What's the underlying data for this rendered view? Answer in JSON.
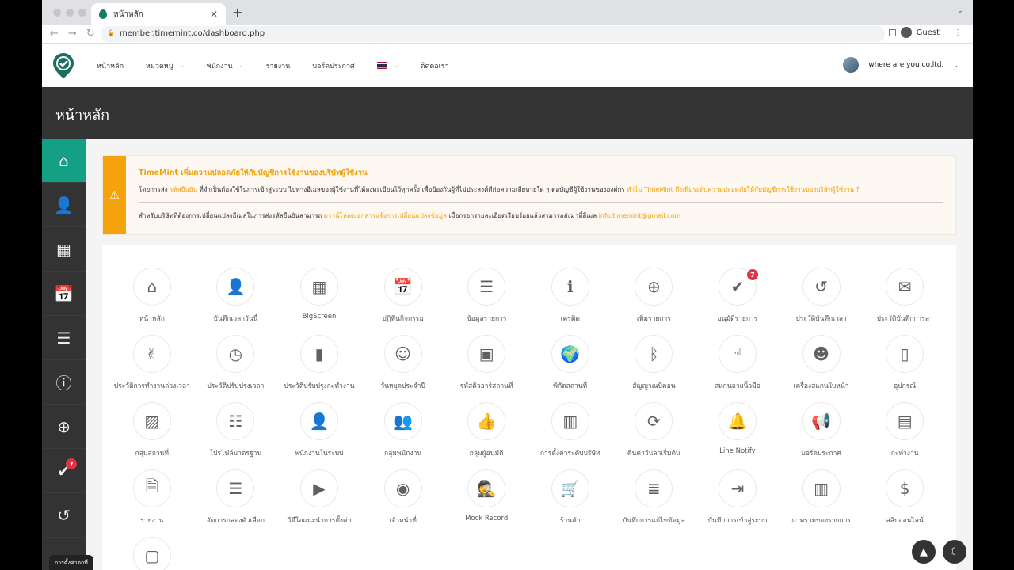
{
  "browser": {
    "tab_title": "หน้าหลัก",
    "url": "member.timemint.co/dashboard.php",
    "profile": "Guest"
  },
  "nav": {
    "items": [
      {
        "label": "หน้าหลัก",
        "dropdown": false
      },
      {
        "label": "หมวดหมู่",
        "dropdown": true
      },
      {
        "label": "พนักงาน",
        "dropdown": true
      },
      {
        "label": "รายงาน",
        "dropdown": false
      },
      {
        "label": "บอร์ดประกาศ",
        "dropdown": false
      },
      {
        "label": "",
        "flag": "thai-flag",
        "dropdown": true
      },
      {
        "label": "ติดต่อเรา",
        "dropdown": false
      }
    ],
    "company": "where are you co.ltd."
  },
  "header": {
    "title": "หน้าหลัก"
  },
  "sidebar": {
    "items": [
      {
        "icon": "home-icon",
        "glyph": "⌂",
        "active": true
      },
      {
        "icon": "user-clock-icon",
        "glyph": "👤"
      },
      {
        "icon": "table-icon",
        "glyph": "▦"
      },
      {
        "icon": "calendar-icon",
        "glyph": "📅"
      },
      {
        "icon": "list-icon",
        "glyph": "☰"
      },
      {
        "icon": "info-icon",
        "glyph": "ⓘ"
      },
      {
        "icon": "plus-circle-icon",
        "glyph": "⊕"
      },
      {
        "icon": "check-circle-icon",
        "glyph": "✔",
        "badge": "7"
      },
      {
        "icon": "history-icon",
        "glyph": "↺"
      },
      {
        "icon": "more-icon",
        "glyph": "▭"
      }
    ],
    "tooltip": "การตั้งค่าตกที่"
  },
  "alert": {
    "title": "TimeMint เพิ่มความปลอดภัยให้กับบัญชีการใช้งานของบริษัทผู้ใช้งาน",
    "line1_a": "โดยการส่ง ",
    "line1_hl": "รหัสยืนยัน",
    "line1_b": " ที่จำเป็นต้องใช้ในการเข้าสู่ระบบ ไปทางอีเมลของผู้ใช้งานที่ได้ลงทะเบียนไว้ทุกครั้ง เพื่อป้องกันผู้ที่ไม่ประสงค์ดีก่อความเสียหายใด ๆ ต่อบัญชีผู้ใช้งานขององค์กร ",
    "line1_link": "ทำไม TimeMint ถึงเพิ่มระดับความปลอดภัยให้กับบัญชีการใช้งานของบริษัทผู้ใช้งาน ?",
    "line2_a": "สำหรับบริษัทที่ต้องการเปลี่ยนแปลงอีเมลในการส่งรหัสยืนยันสามารถ ",
    "line2_link": "ดาวน์โหลดเอกสารแจ้งการเปลี่ยนแปลงข้อมูล",
    "line2_b": " เมื่อกรอกรายละเอียดเรียบร้อยแล้วสามารถส่งมาที่อีเมล ",
    "email": "info.timemint@gmail.com"
  },
  "tiles": [
    {
      "label": "หน้าหลัก",
      "icon": "home-icon",
      "glyph": "⌂"
    },
    {
      "label": "บันทึกเวลาวันนี้",
      "icon": "user-clock-icon",
      "glyph": "👤"
    },
    {
      "label": "BigScreen",
      "icon": "table-icon",
      "glyph": "▦"
    },
    {
      "label": "ปฏิทินกิจกรรม",
      "icon": "calendar-icon",
      "glyph": "📅"
    },
    {
      "label": "ข้อมูลรายการ",
      "icon": "list-icon",
      "glyph": "☰"
    },
    {
      "label": "เครดิต",
      "icon": "info-icon",
      "glyph": "ℹ"
    },
    {
      "label": "เพิ่มรายการ",
      "icon": "plus-circle-icon",
      "glyph": "⊕"
    },
    {
      "label": "อนุมัติรายการ",
      "icon": "check-circle-icon",
      "glyph": "✔",
      "badge": "7"
    },
    {
      "label": "ประวัติบันทึกเวลา",
      "icon": "history-icon",
      "glyph": "↺"
    },
    {
      "label": "ประวัติบันทึกการลา",
      "icon": "envelope-icon",
      "glyph": "✉"
    },
    {
      "label": "ประวัติการทำงานล่วงเวลา",
      "icon": "hand-peace-icon",
      "glyph": "✌"
    },
    {
      "label": "ประวัติปรับปรุงเวลา",
      "icon": "clock-icon",
      "glyph": "◷"
    },
    {
      "label": "ประวัติปรับปรุงกะทำงาน",
      "icon": "book-icon",
      "glyph": "▮"
    },
    {
      "label": "วันหยุดประจำปี",
      "icon": "smile-icon",
      "glyph": "☺"
    },
    {
      "label": "รหัสคิวอาร์สถานที่",
      "icon": "qrcode-icon",
      "glyph": "▣"
    },
    {
      "label": "พิกัดสถานที่",
      "icon": "globe-icon",
      "glyph": "🌍"
    },
    {
      "label": "สัญญาณบีคอน",
      "icon": "bluetooth-icon",
      "glyph": "ᛒ"
    },
    {
      "label": "สแกนลายนิ้วมือ",
      "icon": "hand-pointer-icon",
      "glyph": "☝"
    },
    {
      "label": "เครื่องสแกนใบหน้า",
      "icon": "face-icon",
      "glyph": "☻"
    },
    {
      "label": "อุปกรณ์",
      "icon": "mobile-icon",
      "glyph": "▯"
    },
    {
      "label": "กลุ่มสถานที่",
      "icon": "image-icon",
      "glyph": "▨"
    },
    {
      "label": "โปรไฟล์มาตรฐาน",
      "icon": "list-alt-icon",
      "glyph": "☷"
    },
    {
      "label": "พนักงานในระบบ",
      "icon": "user-icon",
      "glyph": "👤"
    },
    {
      "label": "กลุ่มพนักงาน",
      "icon": "users-icon",
      "glyph": "👥"
    },
    {
      "label": "กลุ่มผู้อนุมัติ",
      "icon": "thumbs-up-icon",
      "glyph": "👍"
    },
    {
      "label": "การตั้งค่าระดับบริษัท",
      "icon": "building-icon",
      "glyph": "▥"
    },
    {
      "label": "คืนค่าวันลาเริ่มต้น",
      "icon": "sync-icon",
      "glyph": "⟳"
    },
    {
      "label": "Line Notify",
      "icon": "bell-icon",
      "glyph": "🔔"
    },
    {
      "label": "บอร์ดประกาศ",
      "icon": "bullhorn-icon",
      "glyph": "📢"
    },
    {
      "label": "กะทำงาน",
      "icon": "book-icon",
      "glyph": "▤"
    },
    {
      "label": "รายงาน",
      "icon": "file-icon",
      "glyph": "🗎"
    },
    {
      "label": "จัดการกล่องตัวเลือก",
      "icon": "list-ul-icon",
      "glyph": "☰"
    },
    {
      "label": "วีดีโอแนะนำการตั้งค่า",
      "icon": "youtube-icon",
      "glyph": "▶"
    },
    {
      "label": "เจ้าหน้าที่",
      "icon": "user-circle-icon",
      "glyph": "◉"
    },
    {
      "label": "Mock Record",
      "icon": "user-secret-icon",
      "glyph": "🕵"
    },
    {
      "label": "ร้านค้า",
      "icon": "cart-icon",
      "glyph": "🛒"
    },
    {
      "label": "บันทึกการแก้ไขข้อมูล",
      "icon": "database-icon",
      "glyph": "≣"
    },
    {
      "label": "บันทึกการเข้าสู่ระบบ",
      "icon": "sign-in-icon",
      "glyph": "⇥"
    },
    {
      "label": "ภาพรวมของรายการ",
      "icon": "chart-bar-icon",
      "glyph": "▥"
    },
    {
      "label": "สลิปออนไลน์",
      "icon": "file-invoice-dollar-icon",
      "glyph": "$"
    },
    {
      "label": "",
      "icon": "sticky-note-icon",
      "glyph": "▢"
    }
  ],
  "colors": {
    "accent": "#14a085",
    "warning": "#f6a20d",
    "dark": "#333333",
    "badge": "#dc3545"
  }
}
